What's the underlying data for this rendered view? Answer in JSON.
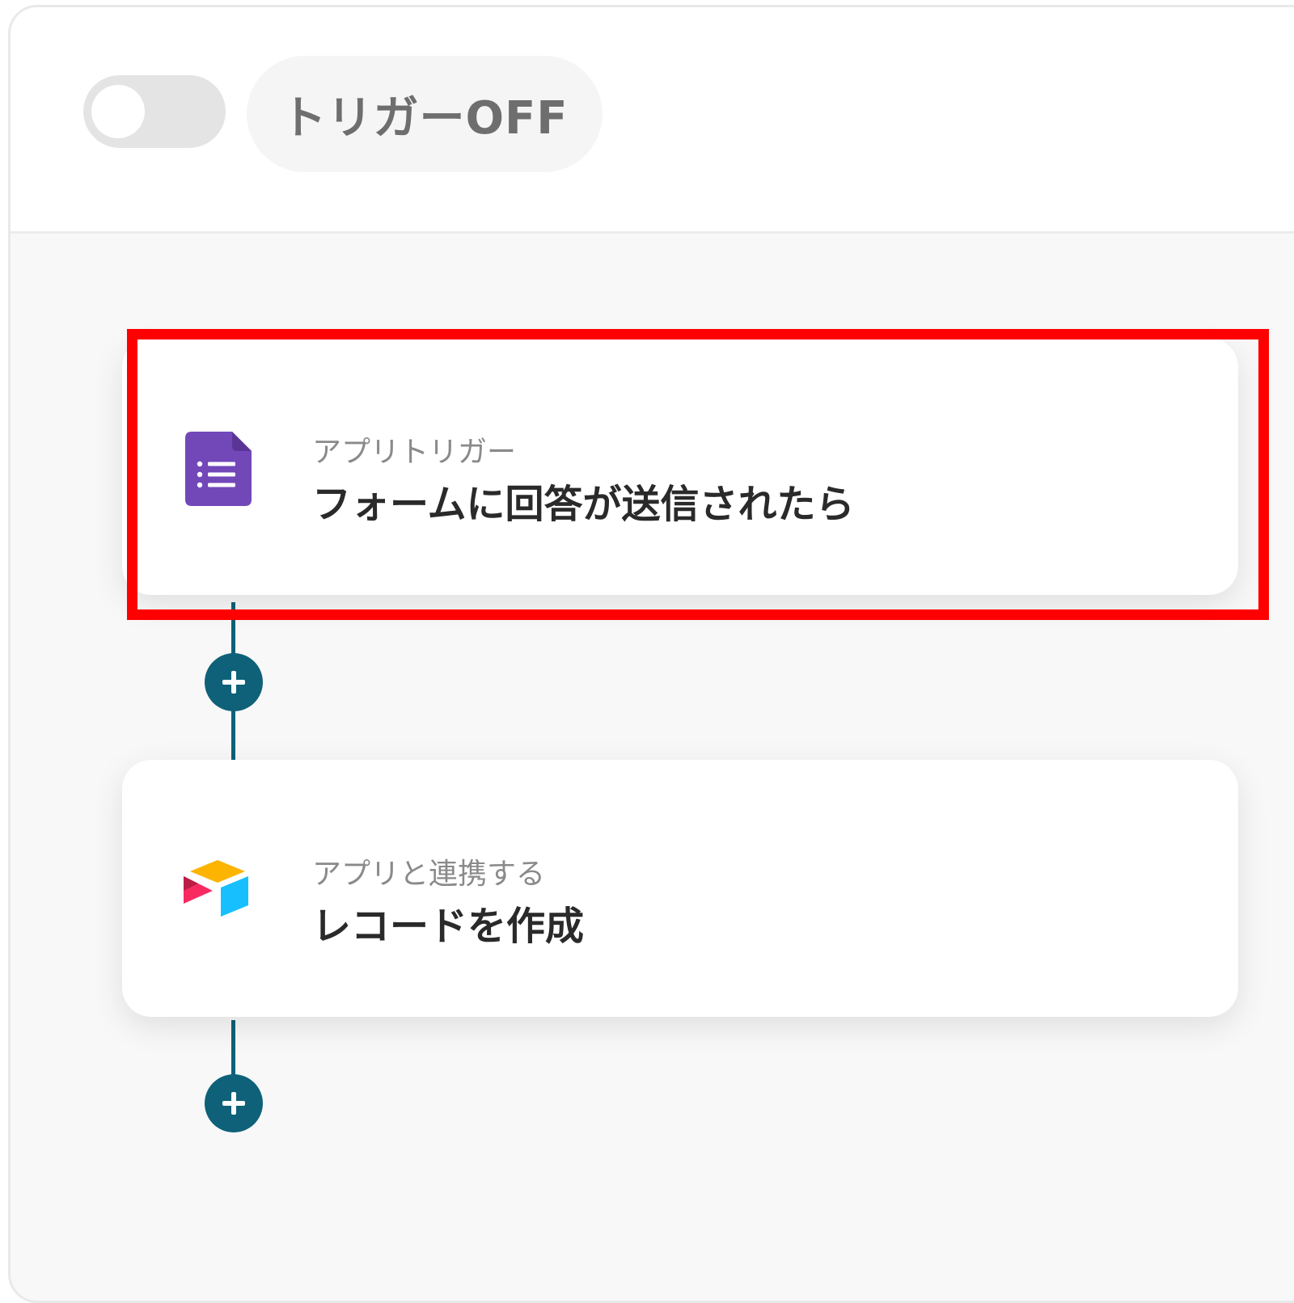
{
  "header": {
    "toggle_state": "off",
    "trigger_status_label": "トリガーOFF"
  },
  "steps": [
    {
      "subtitle": "アプリトリガー",
      "title": "フォームに回答が送信されたら",
      "icon": "google-forms-icon",
      "highlighted": true
    },
    {
      "subtitle": "アプリと連携する",
      "title": "レコードを作成",
      "icon": "airtable-icon",
      "highlighted": false
    }
  ],
  "colors": {
    "accent": "#0e6178",
    "highlight": "#ff0000",
    "forms_purple": "#7248b9"
  }
}
